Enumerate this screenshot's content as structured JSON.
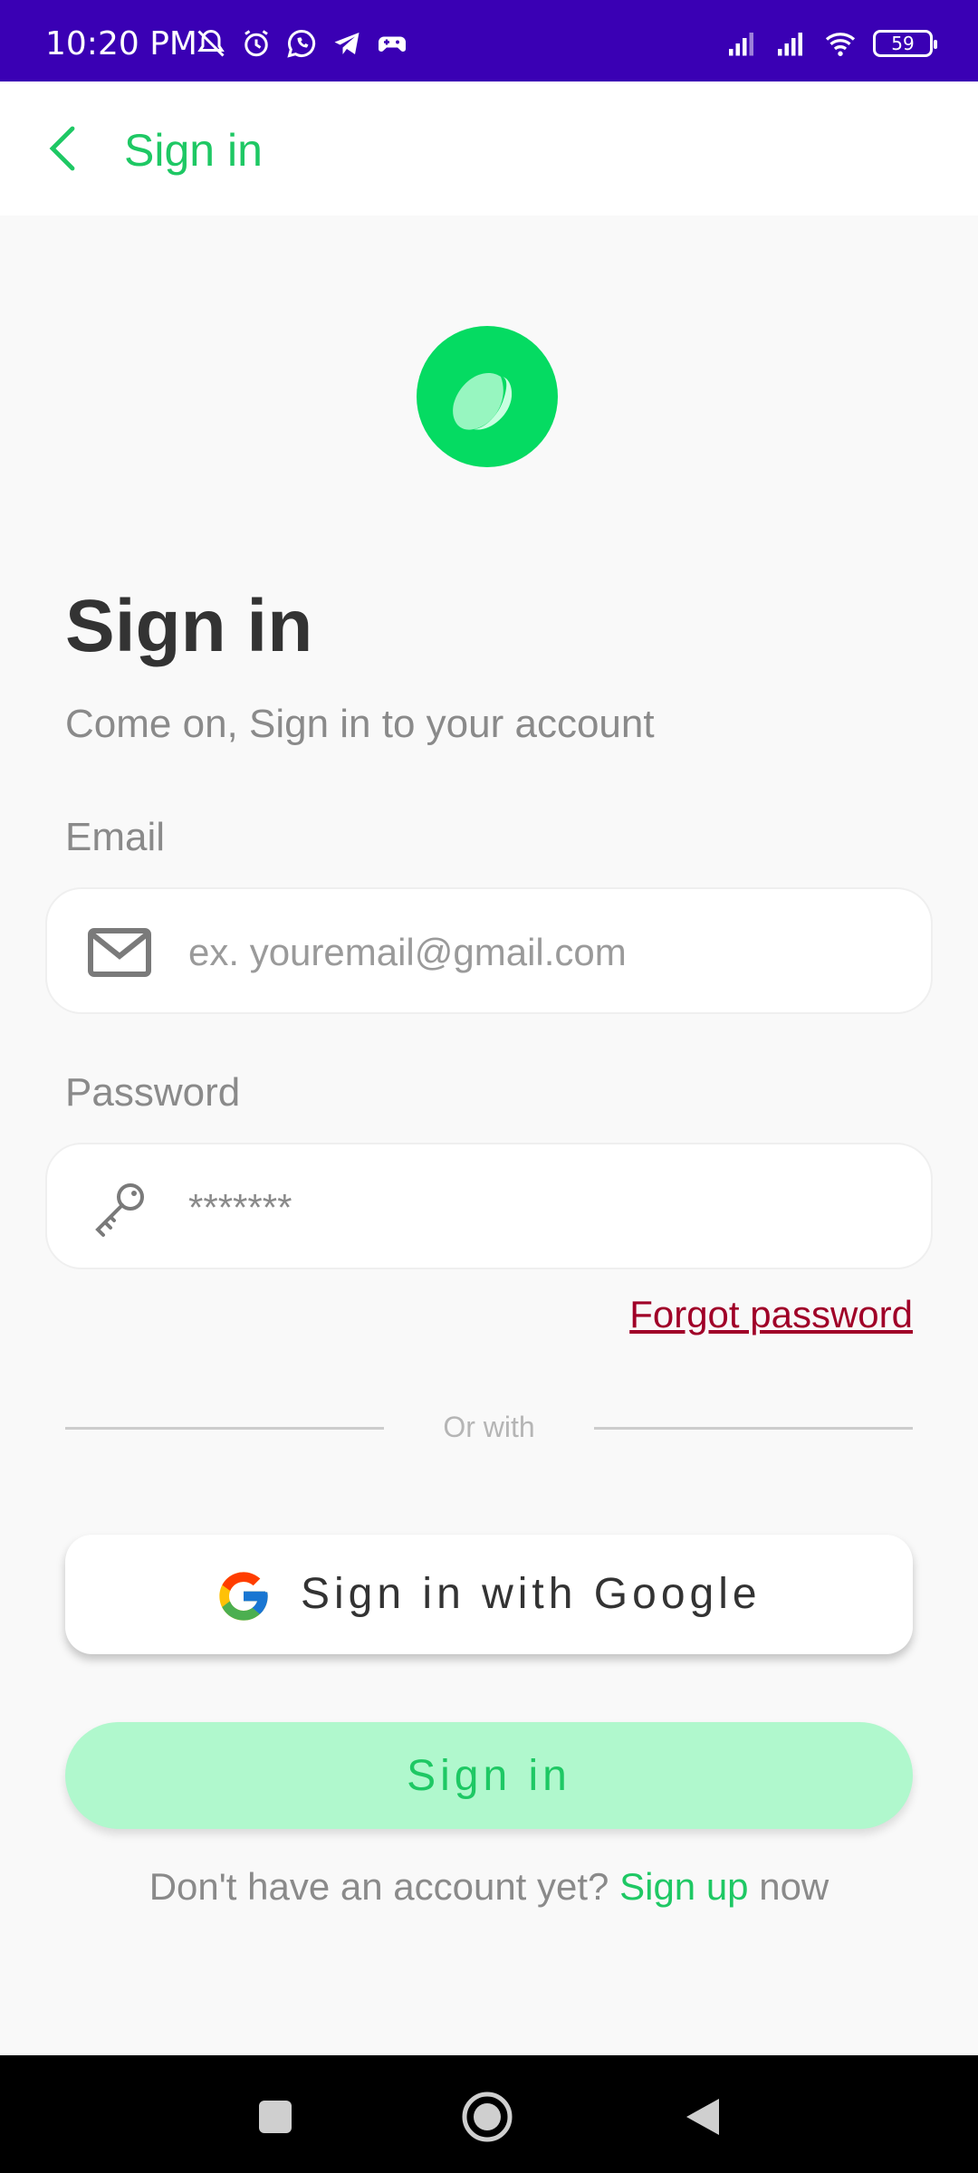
{
  "status_bar": {
    "time": "10:20 PM",
    "battery": "59",
    "left_icons": [
      "mute-bell-icon",
      "alarm-icon",
      "whatsapp-icon",
      "telegram-icon",
      "game-controller-icon"
    ],
    "right_icons": [
      "signal-icon",
      "signal-icon",
      "wifi-icon",
      "battery-icon"
    ]
  },
  "app_bar": {
    "back_icon": "chevron-left-icon",
    "title": "Sign in"
  },
  "logo": {
    "color": "#05db62"
  },
  "heading": "Sign in",
  "subheading": "Come on, Sign in to your account",
  "email": {
    "label": "Email",
    "placeholder": "ex. youremail@gmail.com",
    "value": "",
    "icon": "mail-icon"
  },
  "password": {
    "label": "Password",
    "value": "*******",
    "icon": "key-icon"
  },
  "forgot_password": "Forgot password",
  "divider_text": "Or with",
  "google_button": {
    "label": "Sign in with Google",
    "icon": "google-icon"
  },
  "signin_button": "Sign in",
  "signup_row": {
    "prefix": "Don't have an account yet?",
    "link": "Sign up",
    "suffix": "now"
  },
  "colors": {
    "status_bar": "#3a00b4",
    "accent": "#1ec864",
    "logo": "#05db62",
    "signin_button_bg": "#b0f8cd",
    "forgot_link": "#a00028"
  },
  "nav_bar": {
    "icons": [
      "recents-square-icon",
      "home-circle-icon",
      "back-triangle-icon"
    ]
  }
}
